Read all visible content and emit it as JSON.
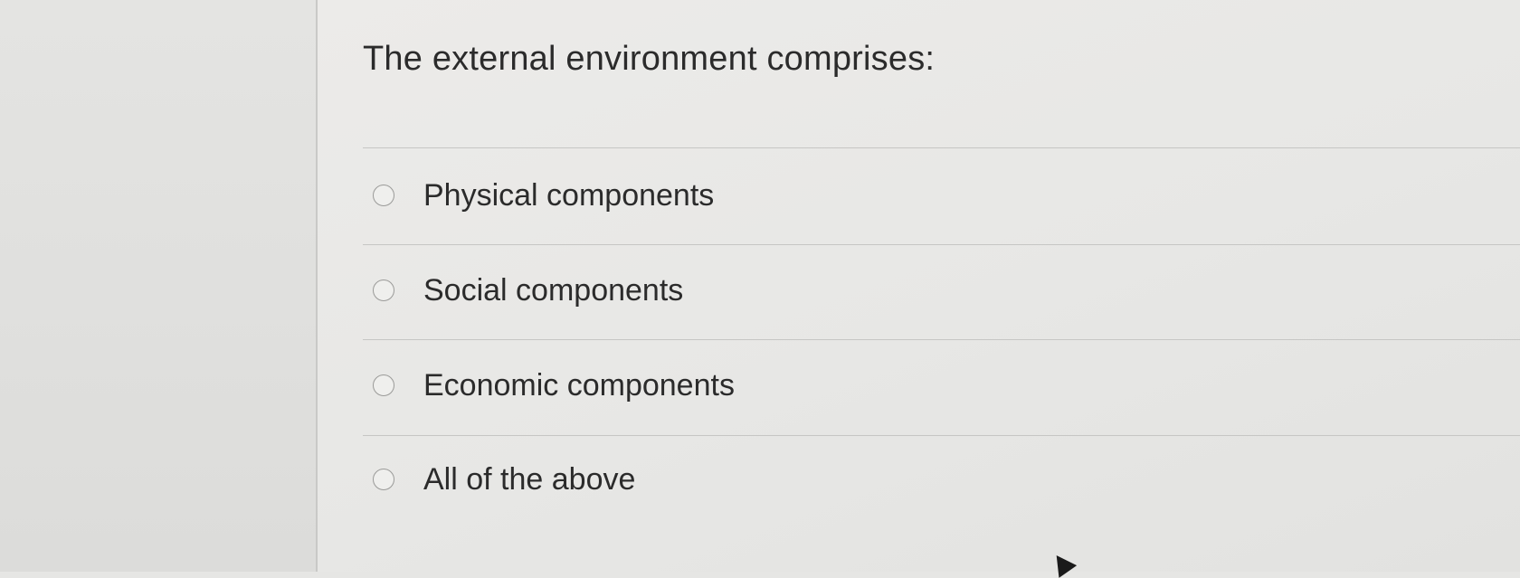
{
  "question": {
    "text": "The external environment comprises:"
  },
  "options": [
    {
      "label": "Physical components",
      "selected": false
    },
    {
      "label": "Social components",
      "selected": false
    },
    {
      "label": "Economic components",
      "selected": false
    },
    {
      "label": "All of the above",
      "selected": false
    }
  ]
}
